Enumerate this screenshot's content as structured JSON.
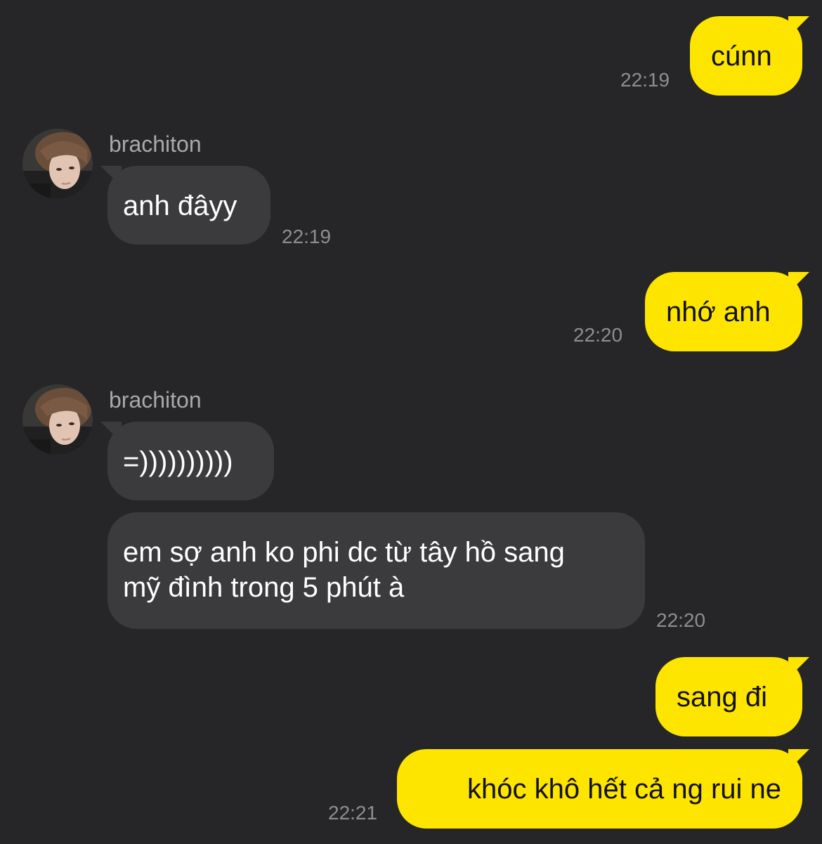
{
  "colors": {
    "background": "#262628",
    "my_bubble": "#fee500",
    "their_bubble": "#3b3b3d",
    "time_text": "#8e8e90",
    "sender_name": "#a9a9ab"
  },
  "messages": [
    {
      "from": "me",
      "text": "cúnn",
      "time": "22:19"
    },
    {
      "from": "them",
      "sender": "brachiton",
      "avatar": "avatar-photo",
      "text": "anh đâyy",
      "time": "22:19"
    },
    {
      "from": "me",
      "text": "nhớ anh",
      "time": "22:20"
    },
    {
      "from": "them",
      "sender": "brachiton",
      "avatar": "avatar-photo",
      "text": "=))))))))))"
    },
    {
      "from": "them",
      "text_lines": [
        "em sợ anh ko phi dc từ tây hồ sang",
        "mỹ đình trong 5 phút à"
      ],
      "time": "22:20"
    },
    {
      "from": "me",
      "text": "sang đi"
    },
    {
      "from": "me",
      "text": "khóc khô hết cả ng rui ne",
      "time": "22:21"
    }
  ]
}
